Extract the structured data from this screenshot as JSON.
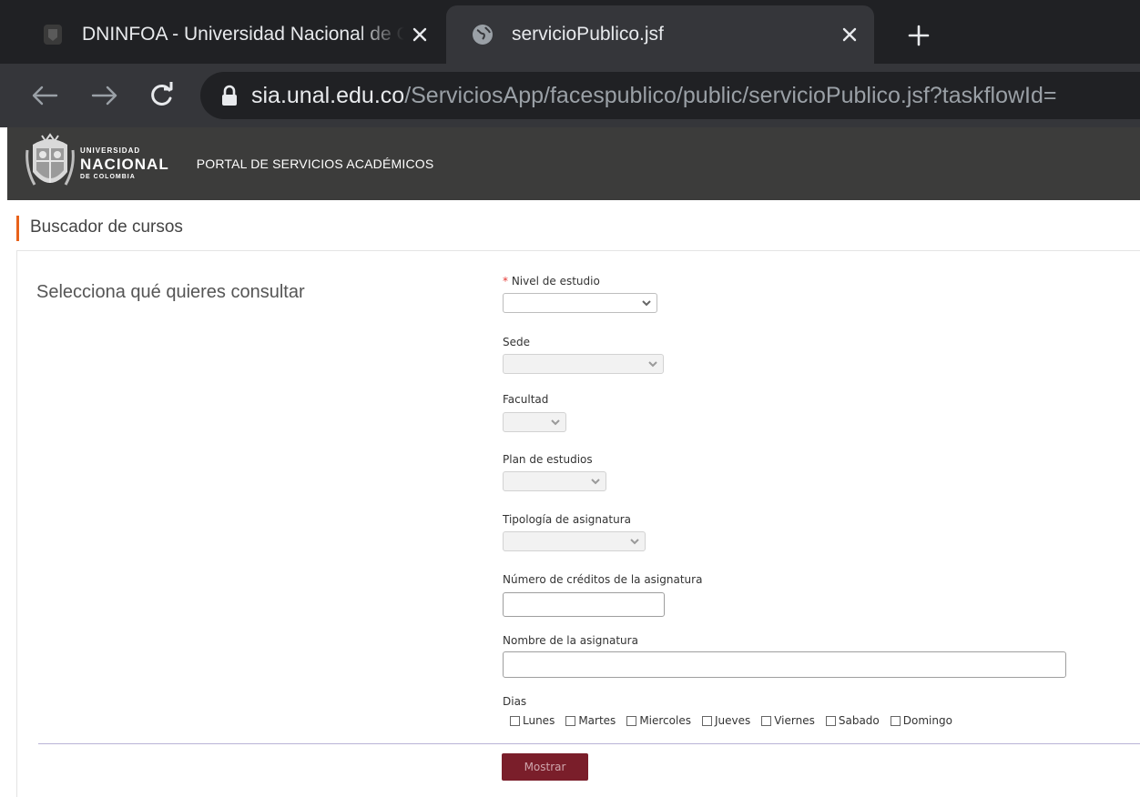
{
  "browser": {
    "tabs": [
      {
        "title": "DNINFOA - Universidad Nacional de Colombia",
        "active": false
      },
      {
        "title": "servicioPublico.jsf",
        "active": true
      }
    ],
    "url_host": "sia.unal.edu.co",
    "url_path": "/ServiciosApp/facespublico/public/servicioPublico.jsf?taskflowId="
  },
  "header": {
    "logo_line1": "UNIVERSIDAD",
    "logo_line2": "NACIONAL",
    "logo_line3": "DE COLOMBIA",
    "portal_title": "PORTAL DE SERVICIOS ACADÉMICOS"
  },
  "page": {
    "heading": "Buscador de cursos",
    "section_title": "Selecciona qué quieres consultar"
  },
  "form": {
    "nivel_label": "Nivel de estudio",
    "required_mark": "*",
    "sede_label": "Sede",
    "facultad_label": "Facultad",
    "plan_label": "Plan de estudios",
    "tipologia_label": "Tipología de asignatura",
    "creditos_label": "Número de créditos de la asignatura",
    "creditos_value": "",
    "nombre_label": "Nombre de la asignatura",
    "nombre_value": "",
    "dias_label": "Dias",
    "days": [
      "Lunes",
      "Martes",
      "Miercoles",
      "Jueves",
      "Viernes",
      "Sabado",
      "Domingo"
    ],
    "submit_label": "Mostrar"
  },
  "colors": {
    "accent_orange": "#e8621a",
    "header_bg": "#3c3c3b",
    "button_bg": "#7a1e2a",
    "required": "#e53935"
  }
}
